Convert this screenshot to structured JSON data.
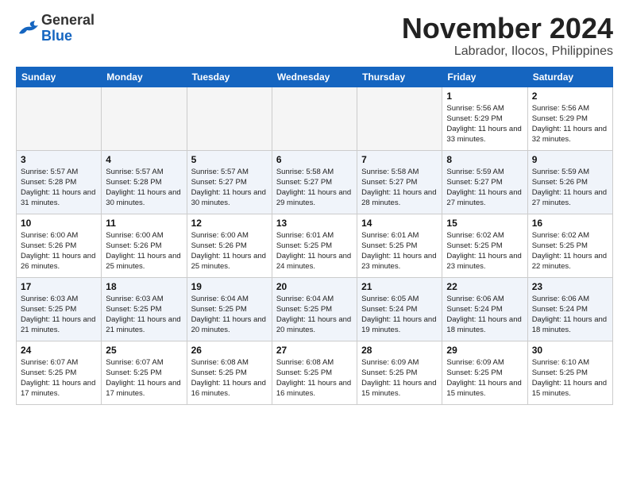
{
  "header": {
    "logo_line1": "General",
    "logo_line2": "Blue",
    "title": "November 2024",
    "location": "Labrador, Ilocos, Philippines"
  },
  "weekdays": [
    "Sunday",
    "Monday",
    "Tuesday",
    "Wednesday",
    "Thursday",
    "Friday",
    "Saturday"
  ],
  "weeks": [
    [
      {
        "day": "",
        "empty": true
      },
      {
        "day": "",
        "empty": true
      },
      {
        "day": "",
        "empty": true
      },
      {
        "day": "",
        "empty": true
      },
      {
        "day": "",
        "empty": true
      },
      {
        "day": "1",
        "sunrise": "Sunrise: 5:56 AM",
        "sunset": "Sunset: 5:29 PM",
        "daylight": "Daylight: 11 hours and 33 minutes."
      },
      {
        "day": "2",
        "sunrise": "Sunrise: 5:56 AM",
        "sunset": "Sunset: 5:29 PM",
        "daylight": "Daylight: 11 hours and 32 minutes."
      }
    ],
    [
      {
        "day": "3",
        "sunrise": "Sunrise: 5:57 AM",
        "sunset": "Sunset: 5:28 PM",
        "daylight": "Daylight: 11 hours and 31 minutes."
      },
      {
        "day": "4",
        "sunrise": "Sunrise: 5:57 AM",
        "sunset": "Sunset: 5:28 PM",
        "daylight": "Daylight: 11 hours and 30 minutes."
      },
      {
        "day": "5",
        "sunrise": "Sunrise: 5:57 AM",
        "sunset": "Sunset: 5:27 PM",
        "daylight": "Daylight: 11 hours and 30 minutes."
      },
      {
        "day": "6",
        "sunrise": "Sunrise: 5:58 AM",
        "sunset": "Sunset: 5:27 PM",
        "daylight": "Daylight: 11 hours and 29 minutes."
      },
      {
        "day": "7",
        "sunrise": "Sunrise: 5:58 AM",
        "sunset": "Sunset: 5:27 PM",
        "daylight": "Daylight: 11 hours and 28 minutes."
      },
      {
        "day": "8",
        "sunrise": "Sunrise: 5:59 AM",
        "sunset": "Sunset: 5:27 PM",
        "daylight": "Daylight: 11 hours and 27 minutes."
      },
      {
        "day": "9",
        "sunrise": "Sunrise: 5:59 AM",
        "sunset": "Sunset: 5:26 PM",
        "daylight": "Daylight: 11 hours and 27 minutes."
      }
    ],
    [
      {
        "day": "10",
        "sunrise": "Sunrise: 6:00 AM",
        "sunset": "Sunset: 5:26 PM",
        "daylight": "Daylight: 11 hours and 26 minutes."
      },
      {
        "day": "11",
        "sunrise": "Sunrise: 6:00 AM",
        "sunset": "Sunset: 5:26 PM",
        "daylight": "Daylight: 11 hours and 25 minutes."
      },
      {
        "day": "12",
        "sunrise": "Sunrise: 6:00 AM",
        "sunset": "Sunset: 5:26 PM",
        "daylight": "Daylight: 11 hours and 25 minutes."
      },
      {
        "day": "13",
        "sunrise": "Sunrise: 6:01 AM",
        "sunset": "Sunset: 5:25 PM",
        "daylight": "Daylight: 11 hours and 24 minutes."
      },
      {
        "day": "14",
        "sunrise": "Sunrise: 6:01 AM",
        "sunset": "Sunset: 5:25 PM",
        "daylight": "Daylight: 11 hours and 23 minutes."
      },
      {
        "day": "15",
        "sunrise": "Sunrise: 6:02 AM",
        "sunset": "Sunset: 5:25 PM",
        "daylight": "Daylight: 11 hours and 23 minutes."
      },
      {
        "day": "16",
        "sunrise": "Sunrise: 6:02 AM",
        "sunset": "Sunset: 5:25 PM",
        "daylight": "Daylight: 11 hours and 22 minutes."
      }
    ],
    [
      {
        "day": "17",
        "sunrise": "Sunrise: 6:03 AM",
        "sunset": "Sunset: 5:25 PM",
        "daylight": "Daylight: 11 hours and 21 minutes."
      },
      {
        "day": "18",
        "sunrise": "Sunrise: 6:03 AM",
        "sunset": "Sunset: 5:25 PM",
        "daylight": "Daylight: 11 hours and 21 minutes."
      },
      {
        "day": "19",
        "sunrise": "Sunrise: 6:04 AM",
        "sunset": "Sunset: 5:25 PM",
        "daylight": "Daylight: 11 hours and 20 minutes."
      },
      {
        "day": "20",
        "sunrise": "Sunrise: 6:04 AM",
        "sunset": "Sunset: 5:25 PM",
        "daylight": "Daylight: 11 hours and 20 minutes."
      },
      {
        "day": "21",
        "sunrise": "Sunrise: 6:05 AM",
        "sunset": "Sunset: 5:24 PM",
        "daylight": "Daylight: 11 hours and 19 minutes."
      },
      {
        "day": "22",
        "sunrise": "Sunrise: 6:06 AM",
        "sunset": "Sunset: 5:24 PM",
        "daylight": "Daylight: 11 hours and 18 minutes."
      },
      {
        "day": "23",
        "sunrise": "Sunrise: 6:06 AM",
        "sunset": "Sunset: 5:24 PM",
        "daylight": "Daylight: 11 hours and 18 minutes."
      }
    ],
    [
      {
        "day": "24",
        "sunrise": "Sunrise: 6:07 AM",
        "sunset": "Sunset: 5:25 PM",
        "daylight": "Daylight: 11 hours and 17 minutes."
      },
      {
        "day": "25",
        "sunrise": "Sunrise: 6:07 AM",
        "sunset": "Sunset: 5:25 PM",
        "daylight": "Daylight: 11 hours and 17 minutes."
      },
      {
        "day": "26",
        "sunrise": "Sunrise: 6:08 AM",
        "sunset": "Sunset: 5:25 PM",
        "daylight": "Daylight: 11 hours and 16 minutes."
      },
      {
        "day": "27",
        "sunrise": "Sunrise: 6:08 AM",
        "sunset": "Sunset: 5:25 PM",
        "daylight": "Daylight: 11 hours and 16 minutes."
      },
      {
        "day": "28",
        "sunrise": "Sunrise: 6:09 AM",
        "sunset": "Sunset: 5:25 PM",
        "daylight": "Daylight: 11 hours and 15 minutes."
      },
      {
        "day": "29",
        "sunrise": "Sunrise: 6:09 AM",
        "sunset": "Sunset: 5:25 PM",
        "daylight": "Daylight: 11 hours and 15 minutes."
      },
      {
        "day": "30",
        "sunrise": "Sunrise: 6:10 AM",
        "sunset": "Sunset: 5:25 PM",
        "daylight": "Daylight: 11 hours and 15 minutes."
      }
    ]
  ]
}
